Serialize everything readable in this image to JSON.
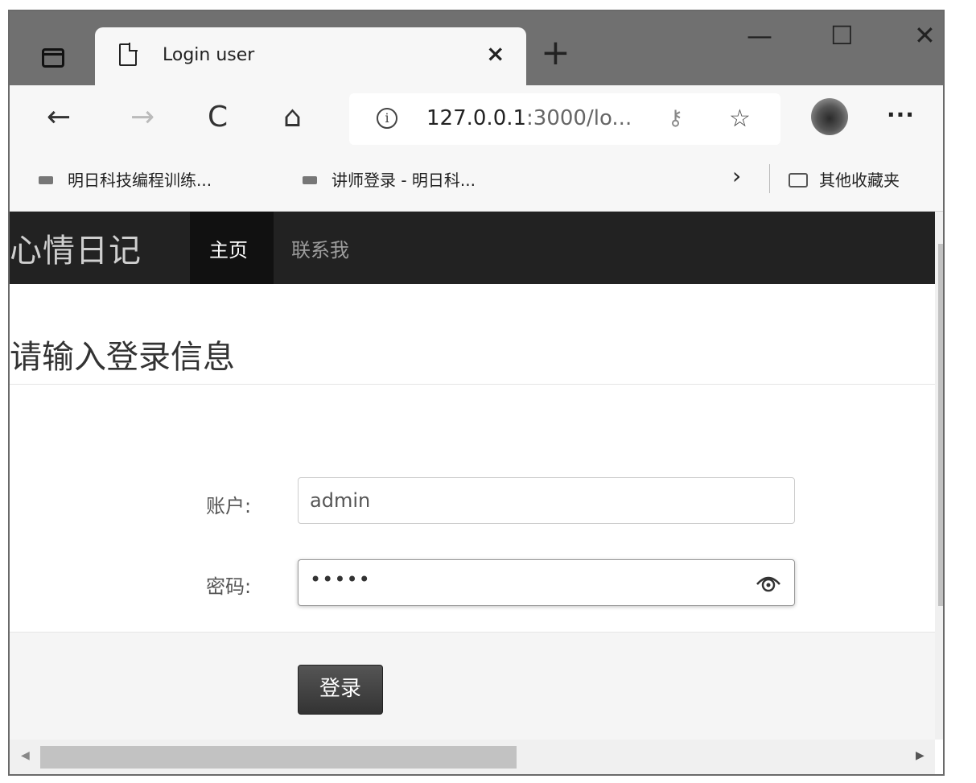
{
  "tab": {
    "title": "Login user",
    "close": "×",
    "new_tab": "+"
  },
  "window_controls": {
    "minimize": "—",
    "maximize": "☐",
    "close": "✕"
  },
  "toolbar": {
    "back": "←",
    "forward": "→",
    "refresh": "C",
    "home": "⌂",
    "url_main": "127.0.0.1",
    "url_rest": ":3000/lo...",
    "more": "···"
  },
  "bookmarks": {
    "items": [
      {
        "label": "明日科技编程训练..."
      },
      {
        "label": "讲师登录 - 明日科..."
      }
    ],
    "chevron": "›",
    "other": "其他收藏夹"
  },
  "navbar": {
    "brand": "心情日记",
    "home": "主页",
    "contact": "联系我"
  },
  "form": {
    "heading": "请输入登录信息",
    "account_label": "账户:",
    "account_value": "admin",
    "password_label": "密码:",
    "password_value": "•••••",
    "submit_label": "登录"
  },
  "scrollbars": {
    "up": "▲",
    "down": "▼",
    "left": "◀",
    "right": "▶"
  },
  "icons": {
    "window": "window-icon",
    "document": "document-icon",
    "info": "info-icon",
    "key": "key-icon",
    "star": "favorite-add-icon",
    "eye": "eye-icon",
    "folder": "folder-icon"
  }
}
